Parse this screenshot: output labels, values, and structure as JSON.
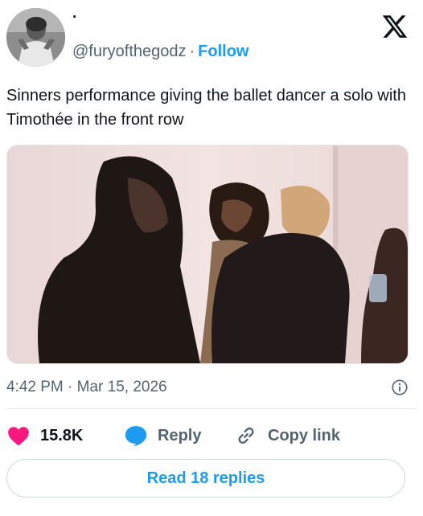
{
  "post": {
    "display_name": "·",
    "handle": "@furyofthegodz",
    "separator": "·",
    "follow_label": "Follow",
    "text": "Sinners performance giving the ballet dancer a solo with Timothée in the front row",
    "timestamp": "4:42 PM · Mar 15, 2026",
    "likes_count": "15.8K",
    "reply_label": "Reply",
    "copy_link_label": "Copy link",
    "read_replies_label": "Read 18 replies"
  },
  "colors": {
    "accent": "#1d9bf0",
    "like": "#f91880",
    "muted": "#536471"
  },
  "icons": [
    "x-logo-icon",
    "info-icon",
    "heart-icon",
    "reply-bubble-icon",
    "link-icon"
  ]
}
